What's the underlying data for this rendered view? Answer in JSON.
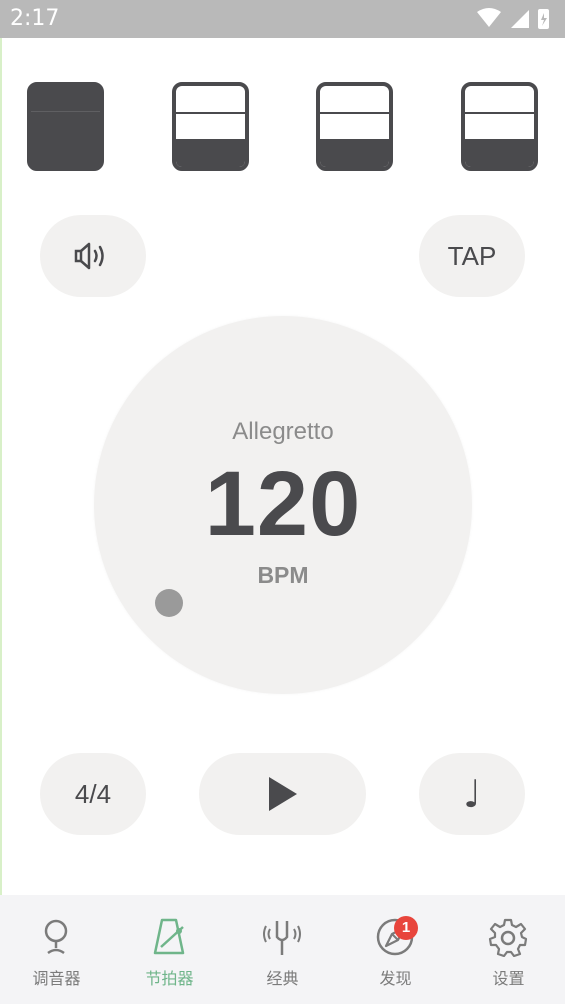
{
  "status_bar": {
    "time": "2:17"
  },
  "beats": [
    "accent",
    "normal",
    "normal",
    "normal"
  ],
  "controls": {
    "sound_label": "",
    "tap_label": "TAP",
    "time_signature": "4/4",
    "note_glyph": "♩"
  },
  "dial": {
    "tempo_name": "Allegretto",
    "bpm": "120",
    "unit": "BPM"
  },
  "tabs": [
    {
      "label": "调音器",
      "icon": "tuner-pin-icon"
    },
    {
      "label": "节拍器",
      "icon": "metronome-icon",
      "active": true
    },
    {
      "label": "经典",
      "icon": "tuning-fork-icon"
    },
    {
      "label": "发现",
      "icon": "compass-icon"
    },
    {
      "label": "设置",
      "icon": "gear-icon"
    }
  ],
  "discover_badge": "1",
  "colors": {
    "accent": "#6fb58a",
    "dark": "#4a4a4d",
    "badge": "#e8453c",
    "pill": "#f2f1f0"
  }
}
